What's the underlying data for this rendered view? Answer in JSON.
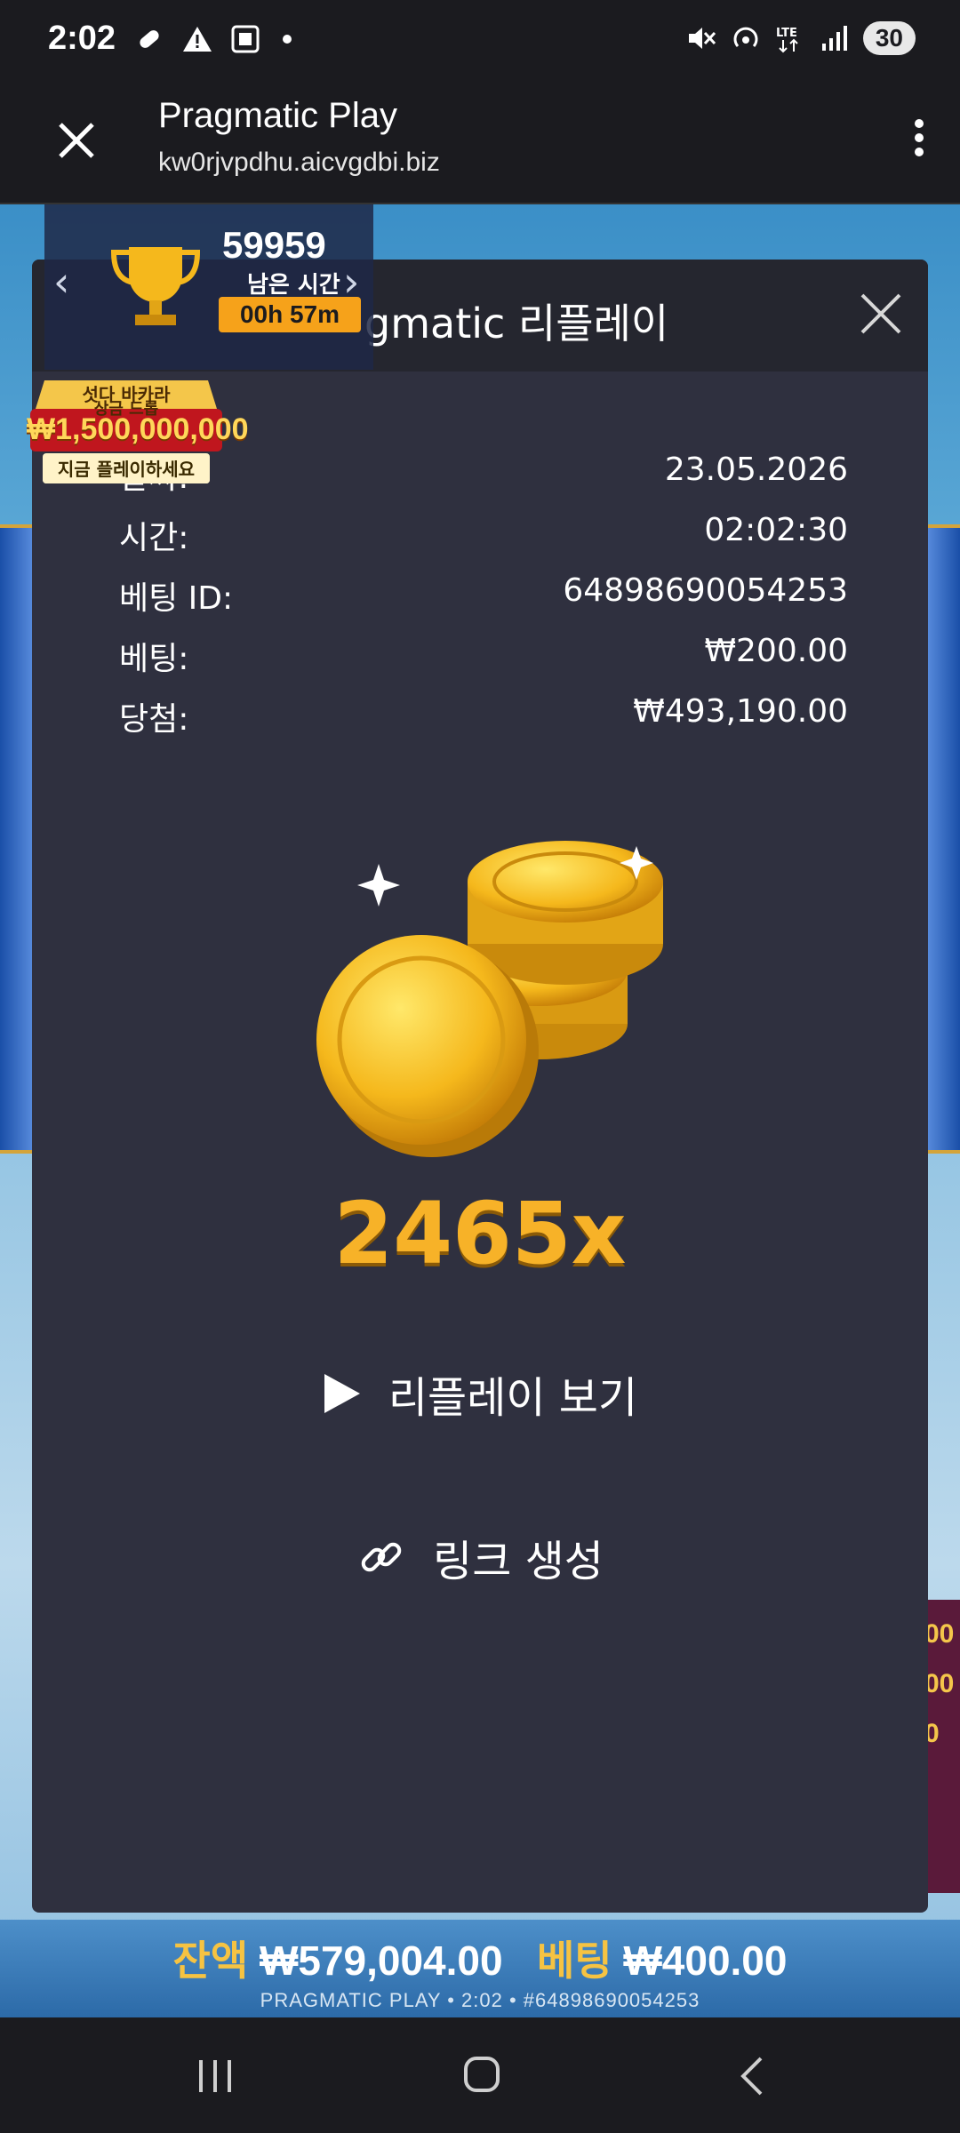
{
  "status_bar": {
    "time": "2:02",
    "left_icons": [
      "pill-icon",
      "warning-icon",
      "screenshot-icon",
      "dot-icon"
    ],
    "right_icons": [
      "mute-icon",
      "hotspot-icon",
      "lte-icon",
      "signal-icon"
    ],
    "battery": "30"
  },
  "browser": {
    "title": "Pragmatic Play",
    "url": "kw0rjvpdhu.aicvgdbi.biz"
  },
  "promo": {
    "count": "59959",
    "remaining_label": "남은 시간",
    "timer": "00h 57m",
    "badge_line1": "섯다 바카라",
    "badge_line2": "상금 드롭",
    "badge_amount": "₩1,500,000,000",
    "badge_cta": "지금 플레이하세요"
  },
  "modal": {
    "title": "gmatic 리플레이",
    "rows": [
      {
        "label": "날짜:",
        "value": "23.05.2026"
      },
      {
        "label": "시간:",
        "value": "02:02:30"
      },
      {
        "label": "베팅 ID:",
        "value": "64898690054253"
      },
      {
        "label": "베팅:",
        "value": "₩200.00"
      },
      {
        "label": "당첨:",
        "value": "₩493,190.00"
      }
    ],
    "multiplier": "2465x",
    "replay_label": "리플레이 보기",
    "link_label": "링크 생성"
  },
  "game": {
    "side_values": [
      "00",
      "00",
      "0"
    ],
    "balance_label": "잔액",
    "balance_value": "₩579,004.00",
    "bet_label": "베팅",
    "bet_value": "₩400.00",
    "footer": "PRAGMATIC PLAY • 2:02 • #64898690054253"
  },
  "colors": {
    "modal_bg": "#2f303f",
    "header_bg": "#25262f",
    "gold": "#f7b228",
    "timer_bg": "#f6a21a"
  }
}
